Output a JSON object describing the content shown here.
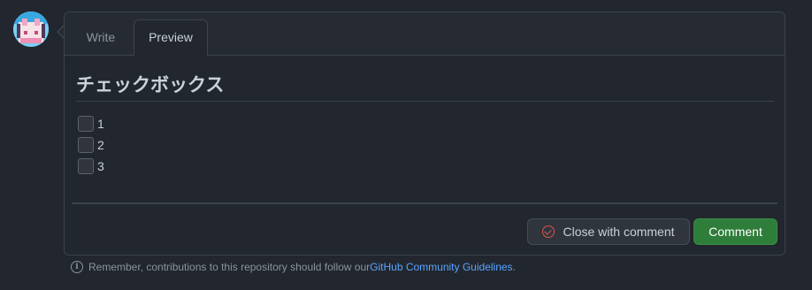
{
  "tabs": {
    "write": "Write",
    "preview": "Preview"
  },
  "preview": {
    "heading": "チェックボックス",
    "tasks": [
      {
        "label": "1",
        "checked": false
      },
      {
        "label": "2",
        "checked": false
      },
      {
        "label": "3",
        "checked": false
      }
    ]
  },
  "actions": {
    "close_label": "Close with comment",
    "comment_label": "Comment"
  },
  "guidelines": {
    "prefix": "Remember, contributions to this repository should follow our ",
    "link": "GitHub Community Guidelines",
    "suffix": "."
  },
  "colors": {
    "background": "#22262e",
    "accent_green": "#2f7d3a",
    "link_blue": "#58a6ff",
    "close_red": "#d9534f"
  },
  "icons": {
    "avatar": "avatar-image",
    "close": "circle-check-icon",
    "info": "info-icon"
  }
}
